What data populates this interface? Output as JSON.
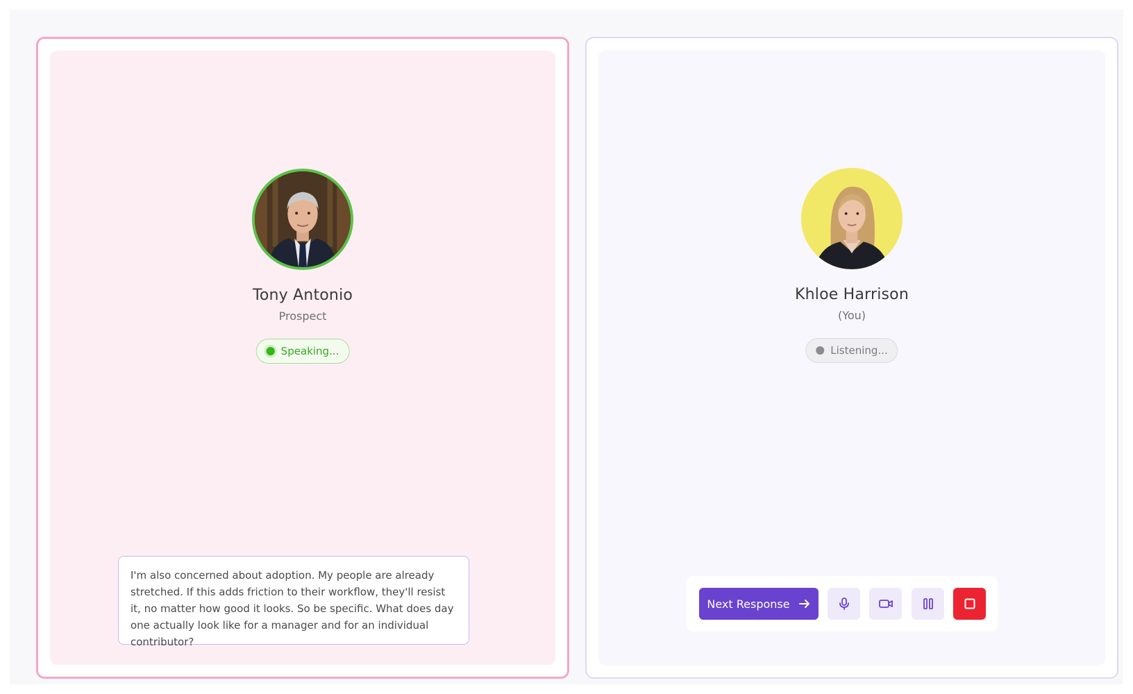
{
  "prospect": {
    "name": "Tony Antonio",
    "role": "Prospect",
    "status": "Speaking...",
    "avatar": "portrait-man-icon",
    "quote": "I'm also concerned about adoption. My people are already stretched. If this adds friction to their workflow, they'll resist it, no matter how good it looks. So be specific. What does day one actually look like for a manager and for an individual contributor?"
  },
  "user": {
    "name": "Khloe Harrison",
    "role": "(You)",
    "status": "Listening...",
    "avatar": "portrait-woman-icon"
  },
  "controls": {
    "next_label": "Next Response",
    "icons": [
      "arrow-right-icon",
      "microphone-icon",
      "video-camera-icon",
      "pause-icon",
      "stop-icon"
    ]
  },
  "colors": {
    "prospect_border": "#f4a6c6",
    "speaking_green": "#36b31d",
    "accent_purple": "#6a42d0",
    "stop_red": "#ec2330",
    "khloe_avatar_bg": "#f2e868"
  }
}
